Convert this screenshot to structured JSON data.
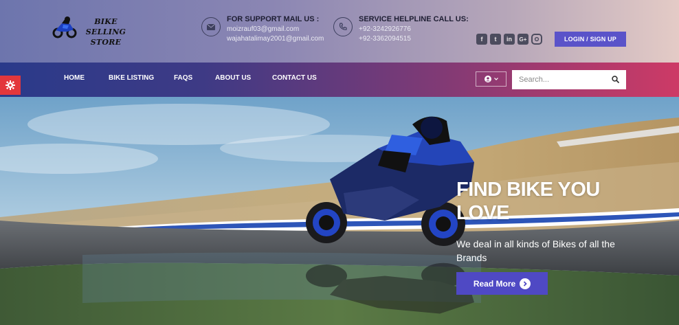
{
  "brand": {
    "line1": "BIKE SELLING",
    "line2": "STORE"
  },
  "support": {
    "title": "FOR SUPPORT MAIL US :",
    "emails": [
      "moizrauf03@gmail.com",
      "wajahatalimay2001@gmail.com"
    ],
    "icon": "envelope-icon"
  },
  "helpline": {
    "title": "SERVICE HELPLINE CALL US:",
    "phones": [
      "+92-3242926776",
      "+92-3362094515"
    ],
    "icon": "phone-icon"
  },
  "social": [
    {
      "name": "facebook-icon",
      "glyph": "f"
    },
    {
      "name": "twitter-icon",
      "glyph": "t"
    },
    {
      "name": "linkedin-icon",
      "glyph": "in"
    },
    {
      "name": "google-plus-icon",
      "glyph": "G+"
    },
    {
      "name": "instagram-icon",
      "glyph": ""
    }
  ],
  "login_label": "LOGIN / SIGN UP",
  "nav": {
    "items": [
      "HOME",
      "BIKE LISTING",
      "FAQS",
      "ABOUT US",
      "CONTACT US"
    ]
  },
  "search": {
    "placeholder": "Search..."
  },
  "hero": {
    "title": "FIND BIKE YOU LOVE",
    "subtitle": "We deal in all kinds of Bikes of all the Brands",
    "button": "Read More"
  },
  "colors": {
    "accent": "#5a53c9",
    "gear_button": "#e3373c"
  }
}
